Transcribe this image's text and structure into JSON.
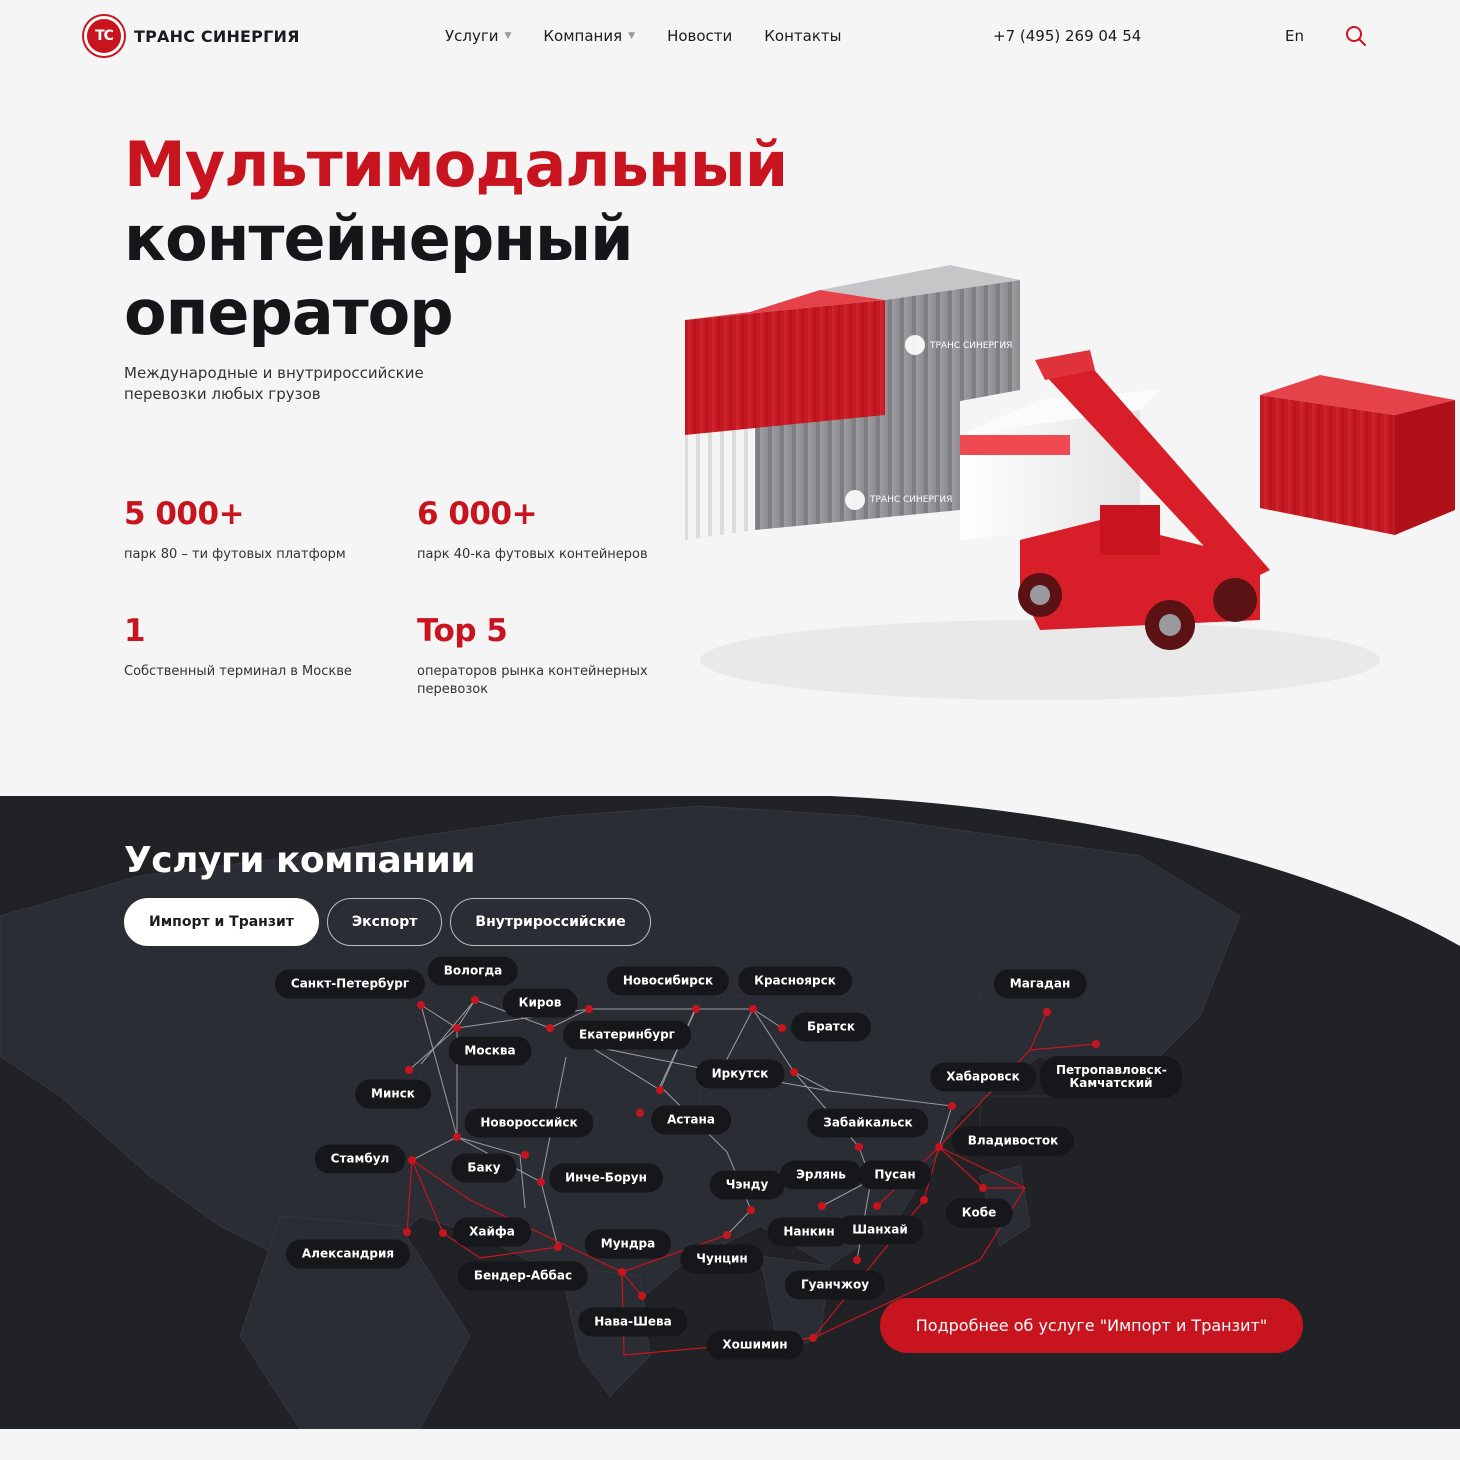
{
  "header": {
    "logo_mark": "ТС",
    "logo_text": "ТРАНС СИНЕРГИЯ",
    "nav": [
      {
        "label": "Услуги",
        "has_dropdown": true
      },
      {
        "label": "Компания",
        "has_dropdown": true
      },
      {
        "label": "Новости",
        "has_dropdown": false
      },
      {
        "label": "Контакты",
        "has_dropdown": false
      }
    ],
    "phone": "+7 (495) 269 04 54",
    "lang": "En"
  },
  "hero": {
    "title_line1": "Мультимодальный",
    "title_line2": "контейнерный",
    "title_line3": "оператор",
    "subtitle": "Международные и внутрироссийские перевозки любых грузов",
    "container_logo_text": "ТРАНС СИНЕРГИЯ",
    "stats": [
      {
        "value": "5 000+",
        "label": "парк 80 – ти футовых платформ"
      },
      {
        "value": "6 000+",
        "label": "парк 40-ка футовых контейнеров"
      },
      {
        "value": "1",
        "label": "Собственный терминал в Москве"
      },
      {
        "value": "Top 5",
        "label": "операторов рынка контейнерных перевозок"
      }
    ]
  },
  "services": {
    "title": "Услуги компании",
    "tabs": [
      {
        "label": "Импорт и Транзит",
        "active": true
      },
      {
        "label": "Экспорт",
        "active": false
      },
      {
        "label": "Внутрироссийские",
        "active": false
      }
    ],
    "cities": [
      "Санкт-Петербург",
      "Вологда",
      "Киров",
      "Новосибирск",
      "Красноярск",
      "Магадан",
      "Екатеринбург",
      "Братск",
      "Москва",
      "Петропавловск-Камчатский",
      "Минск",
      "Иркутск",
      "Хабаровск",
      "Новороссийск",
      "Астана",
      "Забайкальск",
      "Владивосток",
      "Стамбул",
      "Баку",
      "Инче-Борун",
      "Чэнду",
      "Эрлянь",
      "Пусан",
      "Кобе",
      "Хайфа",
      "Нанкин",
      "Шанхай",
      "Александрия",
      "Мундра",
      "Чунцин",
      "Бендер-Аббас",
      "Гуанчжоу",
      "Нава-Шева",
      "Хошимин"
    ],
    "cta": "Подробнее об услуге \"Импорт и Транзит\""
  },
  "colors": {
    "accent": "#c8141e",
    "dark_bg": "#202226",
    "light_bg": "#f5f5f6",
    "text": "#1b1b1f"
  },
  "icons": [
    "chevron-down-icon",
    "search-icon"
  ]
}
